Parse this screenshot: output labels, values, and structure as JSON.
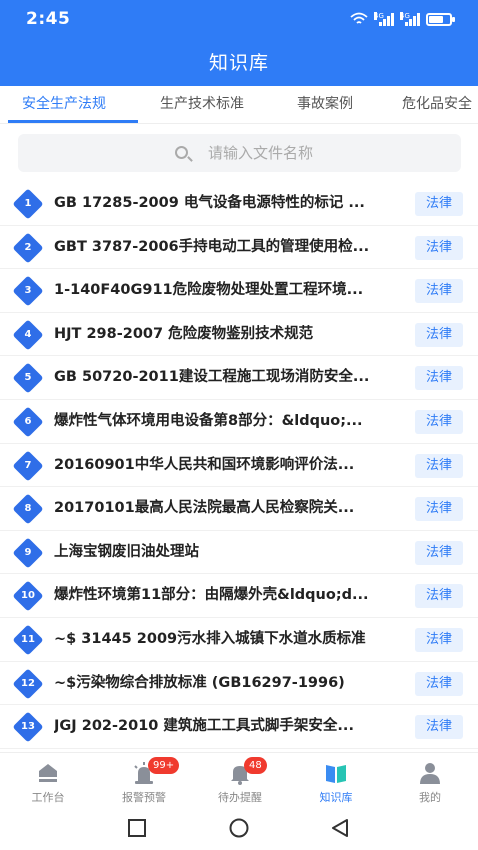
{
  "status_bar": {
    "time": "2:45",
    "network1": "4G",
    "network2": "4G",
    "battery_level": 0.7
  },
  "header": {
    "title": "知识库"
  },
  "tabs": [
    {
      "label": "安全生产法规",
      "active": true
    },
    {
      "label": "生产技术标准",
      "active": false
    },
    {
      "label": "事故案例",
      "active": false
    },
    {
      "label": "危化品安全",
      "active": false
    }
  ],
  "search": {
    "placeholder": "请输入文件名称",
    "value": ""
  },
  "list": [
    {
      "num": "1",
      "title": "GB 17285-2009 电气设备电源特性的标记 ...",
      "tag": "法律"
    },
    {
      "num": "2",
      "title": "GBT 3787-2006手持电动工具的管理使用检...",
      "tag": "法律"
    },
    {
      "num": "3",
      "title": "1-140F40G911危险废物处理处置工程环境...",
      "tag": "法律"
    },
    {
      "num": "4",
      "title": "HJT 298-2007 危险废物鉴别技术规范",
      "tag": "法律"
    },
    {
      "num": "5",
      "title": "GB 50720-2011建设工程施工现场消防安全...",
      "tag": "法律"
    },
    {
      "num": "6",
      "title": "爆炸性气体环境用电设备第8部分：&ldquo;...",
      "tag": "法律"
    },
    {
      "num": "7",
      "title": "20160901中华人民共和国环境影响评价法...",
      "tag": "法律"
    },
    {
      "num": "8",
      "title": "20170101最高人民法院最高人民检察院关...",
      "tag": "法律"
    },
    {
      "num": "9",
      "title": "上海宝钢废旧油处理站",
      "tag": "法律"
    },
    {
      "num": "10",
      "title": "爆炸性环境第11部分：由隔爆外壳&ldquo;d...",
      "tag": "法律"
    },
    {
      "num": "11",
      "title": "~$ 31445 2009污水排入城镇下水道水质标准",
      "tag": "法律"
    },
    {
      "num": "12",
      "title": "~$污染物综合排放标准 (GB16297-1996)",
      "tag": "法律"
    },
    {
      "num": "13",
      "title": "JGJ 202-2010 建筑施工工具式脚手架安全...",
      "tag": "法律"
    }
  ],
  "bottom_nav": [
    {
      "label": "工作台",
      "icon": "workbench-icon",
      "badge": ""
    },
    {
      "label": "报警预警",
      "icon": "alarm-light-icon",
      "badge": "99+"
    },
    {
      "label": "待办提醒",
      "icon": "bell-icon",
      "badge": "48"
    },
    {
      "label": "知识库",
      "icon": "book-icon",
      "badge": "",
      "active": true
    },
    {
      "label": "我的",
      "icon": "user-icon",
      "badge": ""
    }
  ],
  "colors": {
    "primary": "#2f7cf6",
    "badge": "#f03a2e",
    "tag_bg": "#e8f1fe"
  }
}
